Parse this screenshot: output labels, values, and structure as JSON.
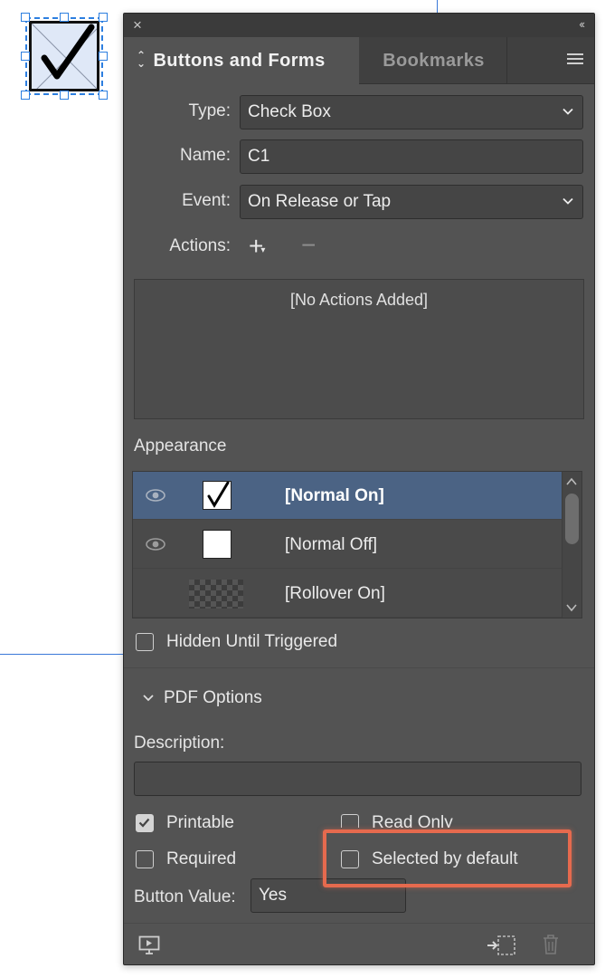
{
  "panel": {
    "tabs": [
      {
        "label": "Buttons and Forms"
      },
      {
        "label": "Bookmarks"
      }
    ],
    "collapse_glyph": "‹‹",
    "close_glyph": "×"
  },
  "form": {
    "type_label": "Type:",
    "type_value": "Check Box",
    "name_label": "Name:",
    "name_value": "C1",
    "event_label": "Event:",
    "event_value": "On Release or Tap",
    "actions_label": "Actions:",
    "add_glyph": "+",
    "remove_glyph": "−",
    "actions_empty": "[No Actions Added]"
  },
  "appearance": {
    "title": "Appearance",
    "states": [
      {
        "name": "[Normal On]",
        "selected": true,
        "visible": true,
        "thumb": "checked"
      },
      {
        "name": "[Normal Off]",
        "selected": false,
        "visible": true,
        "thumb": "blank"
      },
      {
        "name": "[Rollover On]",
        "selected": false,
        "visible": false,
        "thumb": "transparent"
      }
    ]
  },
  "options": {
    "hidden_until_triggered": {
      "label": "Hidden Until Triggered",
      "checked": false
    },
    "pdf_options_title": "PDF Options",
    "description_label": "Description:",
    "description_value": "",
    "printable": {
      "label": "Printable",
      "checked": true
    },
    "read_only": {
      "label": "Read Only",
      "checked": false
    },
    "required": {
      "label": "Required",
      "checked": false
    },
    "selected_by_default": {
      "label": "Selected by default",
      "checked": false
    },
    "button_value_label": "Button Value:",
    "button_value": "Yes"
  },
  "colors": {
    "panel_bg": "#535353",
    "selection": "#4b6384",
    "highlight": "#e66a4e",
    "frame_selection": "#2d7fe0"
  },
  "icons": [
    "close-icon",
    "collapse-icon",
    "panel-menu-icon",
    "chevron-down-icon",
    "eye-icon",
    "preview-icon",
    "convert-to-object-icon",
    "trash-icon"
  ]
}
